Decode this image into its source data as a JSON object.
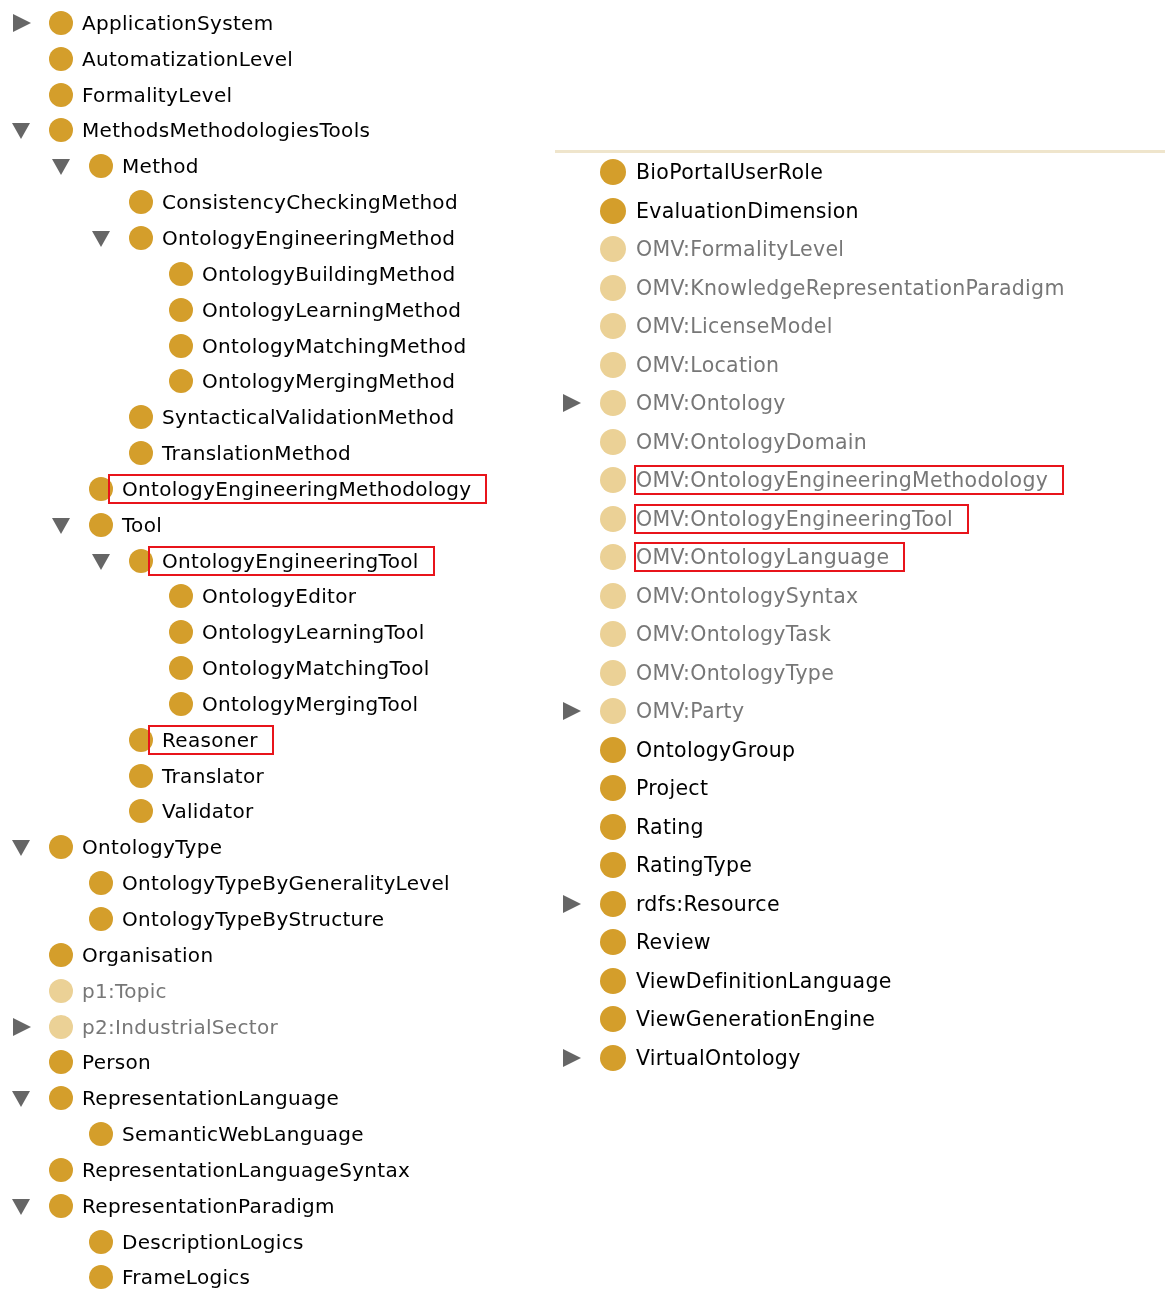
{
  "class_tree": [
    {
      "name": "ApplicationSystem",
      "expanded": false,
      "imported": false,
      "highlighted": false
    },
    {
      "name": "AutomatizationLevel",
      "imported": false,
      "highlighted": false
    },
    {
      "name": "FormalityLevel",
      "imported": false,
      "highlighted": false
    },
    {
      "name": "MethodsMethodologiesTools",
      "expanded": true,
      "imported": false,
      "highlighted": false,
      "children": [
        {
          "name": "Method",
          "expanded": true,
          "imported": false,
          "highlighted": false,
          "children": [
            {
              "name": "ConsistencyCheckingMethod",
              "imported": false,
              "highlighted": false
            },
            {
              "name": "OntologyEngineeringMethod",
              "expanded": true,
              "imported": false,
              "highlighted": false,
              "children": [
                {
                  "name": "OntologyBuildingMethod",
                  "imported": false,
                  "highlighted": false
                },
                {
                  "name": "OntologyLearningMethod",
                  "imported": false,
                  "highlighted": false
                },
                {
                  "name": "OntologyMatchingMethod",
                  "imported": false,
                  "highlighted": false
                },
                {
                  "name": "OntologyMergingMethod",
                  "imported": false,
                  "highlighted": false
                }
              ]
            },
            {
              "name": "SyntacticalValidationMethod",
              "imported": false,
              "highlighted": false
            },
            {
              "name": "TranslationMethod",
              "imported": false,
              "highlighted": false
            }
          ]
        },
        {
          "name": "OntologyEngineeringMethodology",
          "imported": false,
          "highlighted": true
        },
        {
          "name": "Tool",
          "expanded": true,
          "imported": false,
          "highlighted": false,
          "children": [
            {
              "name": "OntologyEngineeringTool",
              "expanded": true,
              "imported": false,
              "highlighted": true,
              "children": [
                {
                  "name": "OntologyEditor",
                  "imported": false,
                  "highlighted": false
                },
                {
                  "name": "OntologyLearningTool",
                  "imported": false,
                  "highlighted": false
                },
                {
                  "name": "OntologyMatchingTool",
                  "imported": false,
                  "highlighted": false
                },
                {
                  "name": "OntologyMergingTool",
                  "imported": false,
                  "highlighted": false
                }
              ]
            },
            {
              "name": "Reasoner",
              "imported": false,
              "highlighted": true
            },
            {
              "name": "Translator",
              "imported": false,
              "highlighted": false
            },
            {
              "name": "Validator",
              "imported": false,
              "highlighted": false
            }
          ]
        }
      ]
    },
    {
      "name": "OntologyType",
      "expanded": true,
      "imported": false,
      "highlighted": false,
      "children": [
        {
          "name": "OntologyTypeByGeneralityLevel",
          "imported": false,
          "highlighted": false
        },
        {
          "name": "OntologyTypeByStructure",
          "imported": false,
          "highlighted": false
        }
      ]
    },
    {
      "name": "Organisation",
      "imported": false,
      "highlighted": false
    },
    {
      "name": "p1:Topic",
      "imported": true,
      "highlighted": false
    },
    {
      "name": "p2:IndustrialSector",
      "expanded": false,
      "imported": true,
      "highlighted": false
    },
    {
      "name": "Person",
      "imported": false,
      "highlighted": false
    },
    {
      "name": "RepresentationLanguage",
      "expanded": true,
      "imported": false,
      "highlighted": false,
      "children": [
        {
          "name": "SemanticWebLanguage",
          "imported": false,
          "highlighted": false
        }
      ]
    },
    {
      "name": "RepresentationLanguageSyntax",
      "imported": false,
      "highlighted": false
    },
    {
      "name": "RepresentationParadigm",
      "expanded": true,
      "imported": false,
      "highlighted": false,
      "children": [
        {
          "name": "DescriptionLogics",
          "imported": false,
          "highlighted": false
        },
        {
          "name": "FrameLogics",
          "imported": false,
          "highlighted": false
        }
      ]
    }
  ],
  "class_list": [
    {
      "name": "BioPortalUserRole",
      "imported": false,
      "highlighted": false
    },
    {
      "name": "EvaluationDimension",
      "imported": false,
      "highlighted": false
    },
    {
      "name": "OMV:FormalityLevel",
      "imported": true,
      "highlighted": false
    },
    {
      "name": "OMV:KnowledgeRepresentationParadigm",
      "imported": true,
      "highlighted": false
    },
    {
      "name": "OMV:LicenseModel",
      "imported": true,
      "highlighted": false
    },
    {
      "name": "OMV:Location",
      "imported": true,
      "highlighted": false
    },
    {
      "name": "OMV:Ontology",
      "expanded": false,
      "imported": true,
      "highlighted": false
    },
    {
      "name": "OMV:OntologyDomain",
      "imported": true,
      "highlighted": false
    },
    {
      "name": "OMV:OntologyEngineeringMethodology",
      "imported": true,
      "highlighted": true
    },
    {
      "name": "OMV:OntologyEngineeringTool",
      "imported": true,
      "highlighted": true
    },
    {
      "name": "OMV:OntologyLanguage",
      "imported": true,
      "highlighted": true
    },
    {
      "name": "OMV:OntologySyntax",
      "imported": true,
      "highlighted": false
    },
    {
      "name": "OMV:OntologyTask",
      "imported": true,
      "highlighted": false
    },
    {
      "name": "OMV:OntologyType",
      "imported": true,
      "highlighted": false
    },
    {
      "name": "OMV:Party",
      "expanded": false,
      "imported": true,
      "highlighted": false
    },
    {
      "name": "OntologyGroup",
      "imported": false,
      "highlighted": false
    },
    {
      "name": "Project",
      "imported": false,
      "highlighted": false
    },
    {
      "name": "Rating",
      "imported": false,
      "highlighted": false
    },
    {
      "name": "RatingType",
      "imported": false,
      "highlighted": false
    },
    {
      "name": "rdfs:Resource",
      "expanded": false,
      "imported": false,
      "highlighted": false
    },
    {
      "name": "Review",
      "imported": false,
      "highlighted": false
    },
    {
      "name": "ViewDefinitionLanguage",
      "imported": false,
      "highlighted": false
    },
    {
      "name": "ViewGenerationEngine",
      "imported": false,
      "highlighted": false
    },
    {
      "name": "VirtualOntology",
      "expanded": false,
      "imported": false,
      "highlighted": false
    }
  ]
}
